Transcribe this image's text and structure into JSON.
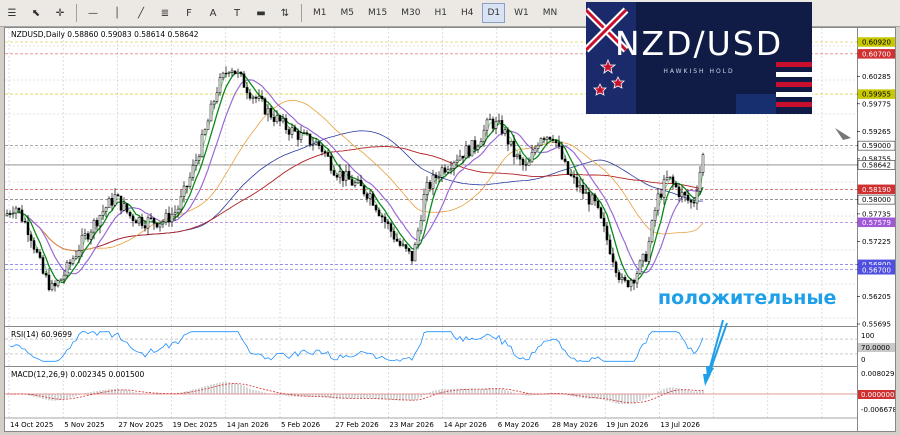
{
  "toolbar": {
    "timeframes": [
      "M1",
      "M5",
      "M15",
      "M30",
      "H1",
      "H4",
      "D1",
      "W1",
      "MN"
    ],
    "active_timeframe": "D1"
  },
  "chart": {
    "header": "NZDUSD,Daily  0.58860 0.59083 0.58614 0.58642",
    "price_axis": [
      "0.60920",
      "0.60700",
      "0.60285",
      "0.59955",
      "0.59775",
      "0.59265",
      "0.59000",
      "0.58755",
      "0.58642",
      "0.58190",
      "0.58000",
      "0.57735",
      "0.57579",
      "0.57225",
      "0.56800",
      "0.56700",
      "0.56205",
      "0.55695"
    ],
    "highlighted_prices": [
      {
        "label": "0.60920",
        "color": "#c8c800"
      },
      {
        "label": "0.60700",
        "color": "#d03030"
      },
      {
        "label": "0.59955",
        "color": "#c8c800"
      },
      {
        "label": "0.59000",
        "color": "#ffffff"
      },
      {
        "label": "0.58642",
        "color": "#ffffff"
      },
      {
        "label": "0.58190",
        "color": "#d03030"
      },
      {
        "label": "0.58000",
        "color": "#ffffff"
      },
      {
        "label": "0.57579",
        "color": "#a058d8"
      },
      {
        "label": "0.56800",
        "color": "#5050e0"
      },
      {
        "label": "0.56700",
        "color": "#5050e0"
      }
    ],
    "dates": [
      "14 Oct 2025",
      "5 Nov 2025",
      "27 Nov 2025",
      "19 Dec 2025",
      "14 Jan 2026",
      "5 Feb 2026",
      "27 Feb 2026",
      "23 Mar 2026",
      "14 Apr 2026",
      "6 May 2026",
      "28 May 2026",
      "19 Jun 2026",
      "13 Jul 2026"
    ]
  },
  "rsi": {
    "label": "RSI(14) 60.9699",
    "axis": [
      "100",
      "70.0000",
      "0"
    ]
  },
  "macd": {
    "label": "MACD(12,26,9) 0.002345 0.001500",
    "axis": [
      "0.008029",
      "0.000000",
      "-0.006678"
    ]
  },
  "banner": {
    "title": "NZD/USD",
    "subtitle": "HAWKISH HOLD"
  },
  "annotation": {
    "text": "положительные",
    "color": "#1ea0e8"
  },
  "colors": {
    "ma_fast": "#6fcf6f",
    "ma_mid": "#0a8a1a",
    "ma_purple": "#9b6bd6",
    "ma_orange": "#e8a040",
    "ma_blue": "#2a3aa0",
    "ma_red": "#b02020"
  }
}
